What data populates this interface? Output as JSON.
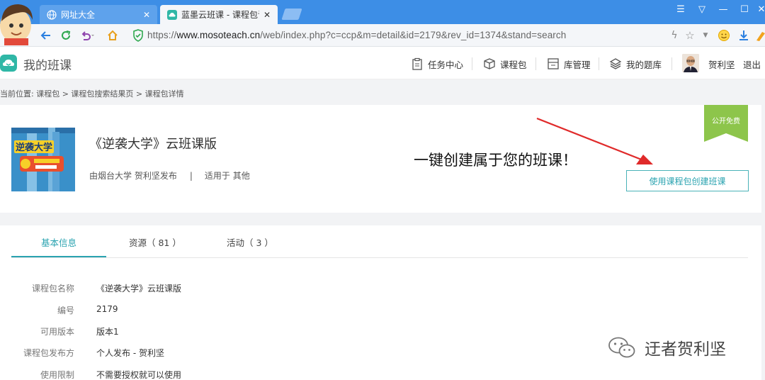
{
  "browser": {
    "tabs": [
      {
        "title": "网址大全"
      },
      {
        "title": "蓝墨云班课 - 课程包详情"
      }
    ],
    "url_prefix": "https://",
    "url_host": "www.mosoteach.cn",
    "url_path": "/web/index.php?c=ccp&m=detail&id=2179&rev_id=1374&stand=search"
  },
  "site": {
    "title": "我的班课",
    "nav": [
      "任务中心",
      "课程包",
      "库管理",
      "我的题库"
    ],
    "username": "贺利坚",
    "logout": "退出"
  },
  "breadcrumb": "当前位置: 课程包 > 课程包搜索结果页 > 课程包详情",
  "course": {
    "title": "《逆袭大学》云班课版",
    "publisher": "由烟台大学 贺利坚发布",
    "separator": "|",
    "applicable": "适用于 其他",
    "ribbon": "公开免费",
    "create_button": "使用课程包创建班课",
    "cover_text": "逆袭大学"
  },
  "callout": "一键创建属于您的班课！",
  "detail_tabs": [
    "基本信息",
    "资源（ 81 ）",
    "活动（ 3 ）"
  ],
  "info": [
    {
      "label": "课程包名称",
      "value": "《逆袭大学》云班课版"
    },
    {
      "label": "编号",
      "value": "2179"
    },
    {
      "label": "可用版本",
      "value": "版本1"
    },
    {
      "label": "课程包发布方",
      "value": "个人发布 - 贺利坚"
    },
    {
      "label": "使用限制",
      "value": "不需要授权就可以使用"
    }
  ],
  "watermark": "迂者贺利坚",
  "colors": {
    "teal": "#2aa3b0",
    "ribbon": "#8dc54b",
    "arrow": "#e02a2a",
    "chrome": "#3d8ee6"
  }
}
